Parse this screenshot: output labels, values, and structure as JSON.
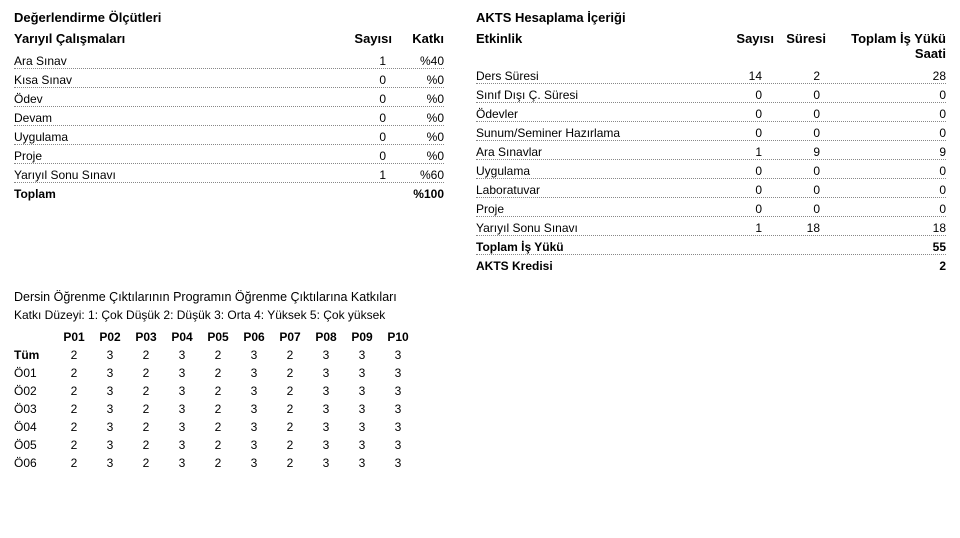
{
  "left": {
    "title": "Değerlendirme Ölçütleri",
    "col_header1": "Yarıyıl Çalışmaları",
    "col_header2": "Sayısı",
    "col_header3": "Katkı",
    "rows": [
      {
        "label": "Ara Sınav",
        "n": "1",
        "k": "%40"
      },
      {
        "label": "Kısa Sınav",
        "n": "0",
        "k": "%0"
      },
      {
        "label": "Ödev",
        "n": "0",
        "k": "%0"
      },
      {
        "label": "Devam",
        "n": "0",
        "k": "%0"
      },
      {
        "label": "Uygulama",
        "n": "0",
        "k": "%0"
      },
      {
        "label": "Proje",
        "n": "0",
        "k": "%0"
      },
      {
        "label": "Yarıyıl Sonu Sınavı",
        "n": "1",
        "k": "%60"
      }
    ],
    "total_label": "Toplam",
    "total_value": "%100"
  },
  "right": {
    "title": "AKTS Hesaplama İçeriği",
    "col_header1": "Etkinlik",
    "col_header2": "Sayısı",
    "col_header3": "Süresi",
    "col_header4": "Toplam İş Yükü Saati",
    "rows": [
      {
        "label": "Ders Süresi",
        "a": "14",
        "b": "2",
        "c": "28"
      },
      {
        "label": "Sınıf Dışı Ç. Süresi",
        "a": "0",
        "b": "0",
        "c": "0"
      },
      {
        "label": "Ödevler",
        "a": "0",
        "b": "0",
        "c": "0"
      },
      {
        "label": "Sunum/Seminer Hazırlama",
        "a": "0",
        "b": "0",
        "c": "0"
      },
      {
        "label": "Ara Sınavlar",
        "a": "1",
        "b": "9",
        "c": "9"
      },
      {
        "label": "Uygulama",
        "a": "0",
        "b": "0",
        "c": "0"
      },
      {
        "label": "Laboratuvar",
        "a": "0",
        "b": "0",
        "c": "0"
      },
      {
        "label": "Proje",
        "a": "0",
        "b": "0",
        "c": "0"
      },
      {
        "label": "Yarıyıl Sonu Sınavı",
        "a": "1",
        "b": "18",
        "c": "18"
      }
    ],
    "total1_label": "Toplam İş Yükü",
    "total1_value": "55",
    "total2_label": "AKTS Kredisi",
    "total2_value": "2"
  },
  "matrix": {
    "title": "Dersin Öğrenme Çıktılarının Programın Öğrenme Çıktılarına Katkıları",
    "subtitle": "Katkı Düzeyi: 1: Çok Düşük 2: Düşük 3: Orta 4: Yüksek 5: Çok yüksek",
    "cols": [
      "P01",
      "P02",
      "P03",
      "P04",
      "P05",
      "P06",
      "P07",
      "P08",
      "P09",
      "P10"
    ],
    "rows": [
      {
        "hdr": "Tüm",
        "bold": true,
        "v": [
          "2",
          "3",
          "2",
          "3",
          "2",
          "3",
          "2",
          "3",
          "3",
          "3"
        ]
      },
      {
        "hdr": "Ö01",
        "v": [
          "2",
          "3",
          "2",
          "3",
          "2",
          "3",
          "2",
          "3",
          "3",
          "3"
        ]
      },
      {
        "hdr": "Ö02",
        "v": [
          "2",
          "3",
          "2",
          "3",
          "2",
          "3",
          "2",
          "3",
          "3",
          "3"
        ]
      },
      {
        "hdr": "Ö03",
        "v": [
          "2",
          "3",
          "2",
          "3",
          "2",
          "3",
          "2",
          "3",
          "3",
          "3"
        ]
      },
      {
        "hdr": "Ö04",
        "v": [
          "2",
          "3",
          "2",
          "3",
          "2",
          "3",
          "2",
          "3",
          "3",
          "3"
        ]
      },
      {
        "hdr": "Ö05",
        "v": [
          "2",
          "3",
          "2",
          "3",
          "2",
          "3",
          "2",
          "3",
          "3",
          "3"
        ]
      },
      {
        "hdr": "Ö06",
        "v": [
          "2",
          "3",
          "2",
          "3",
          "2",
          "3",
          "2",
          "3",
          "3",
          "3"
        ]
      }
    ]
  }
}
